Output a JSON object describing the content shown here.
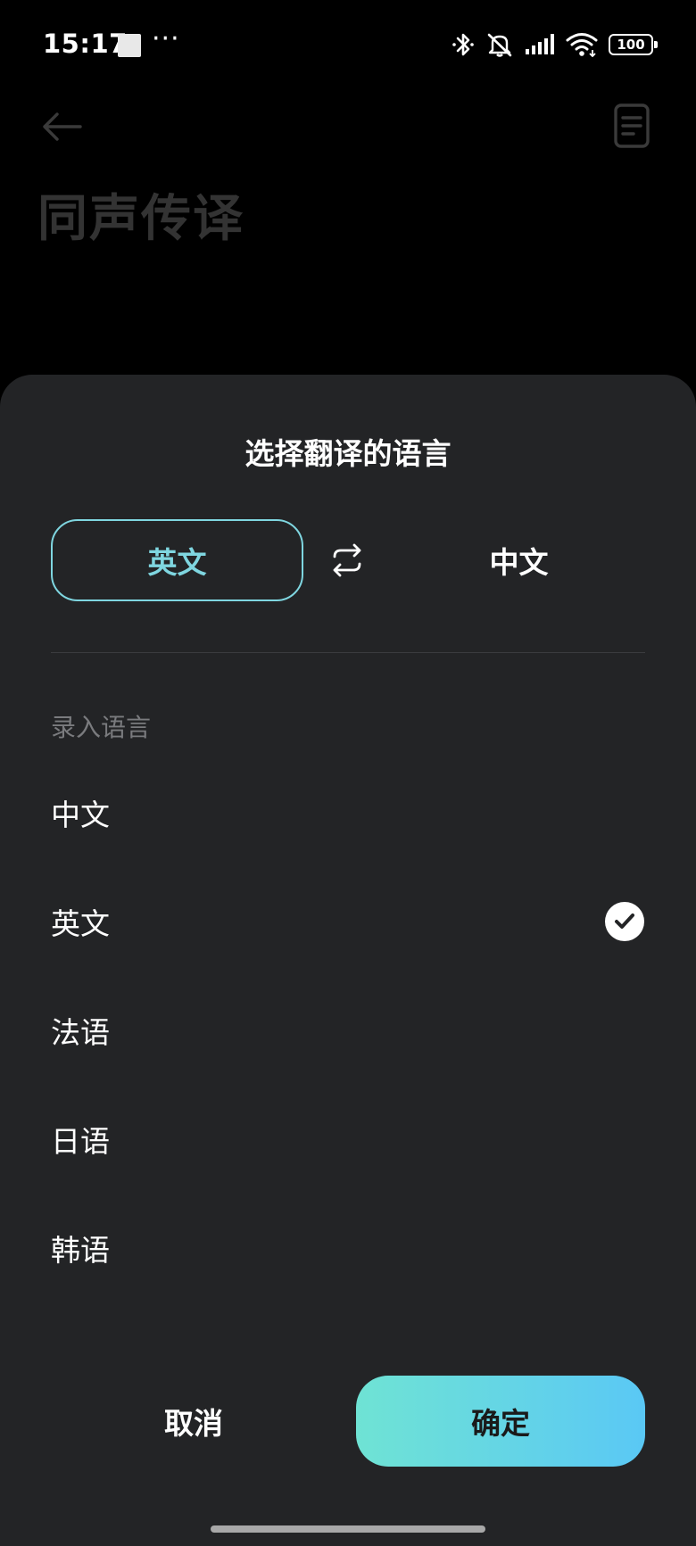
{
  "status_bar": {
    "time": "15:17",
    "dots": "···",
    "battery": "100",
    "icons": [
      "bluetooth-icon",
      "silent-bell-icon",
      "signal-icon",
      "wifi-icon",
      "battery-icon"
    ]
  },
  "background_page": {
    "title": "同声传译",
    "icons": [
      "back-arrow-icon",
      "document-icon"
    ]
  },
  "sheet": {
    "title": "选择翻译的语言",
    "source_language": "英文",
    "target_language": "中文",
    "section_label": "录入语言",
    "languages": [
      {
        "label": "中文",
        "selected": false
      },
      {
        "label": "英文",
        "selected": true
      },
      {
        "label": "法语",
        "selected": false
      },
      {
        "label": "日语",
        "selected": false
      },
      {
        "label": "韩语",
        "selected": false
      }
    ],
    "cancel_label": "取消",
    "confirm_label": "确定"
  },
  "colors": {
    "accent": "#7fd6e0",
    "sheet_bg": "#232426",
    "confirm_gradient_start": "#6fe3d4",
    "confirm_gradient_end": "#5ac8f5"
  }
}
